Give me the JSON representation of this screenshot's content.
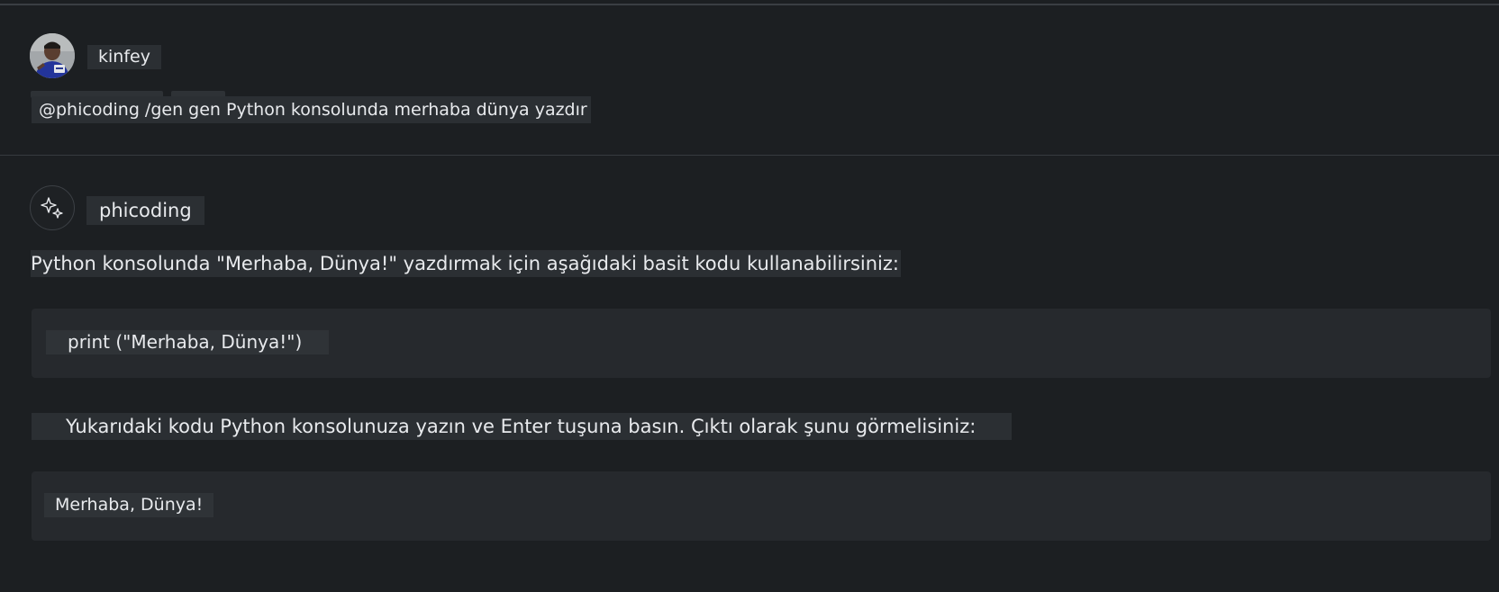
{
  "user": {
    "name": "kinfey",
    "prompt": "@phicoding /gen gen Python konsolunda merhaba dünya yazdır"
  },
  "assistant": {
    "name": "phicoding",
    "intro": "Python konsolunda \"Merhaba, Dünya!\" yazdırmak için aşağıdaki basit kodu kullanabilirsiniz:",
    "code": "print (\"Merhaba, Dünya!\")",
    "instruction": "Yukarıdaki kodu Python konsolunuza yazın ve Enter tuşuna basın. Çıktı olarak şunu görmelisiniz:",
    "output": "Merhaba, Dünya!"
  },
  "icons": {
    "user_avatar": "user-avatar-photo",
    "assistant_avatar": "sparkle-icon"
  },
  "colors": {
    "background": "#1c1f22",
    "text": "#e8eaed",
    "code_block": "#26292d",
    "highlight": "#2b2f33"
  }
}
